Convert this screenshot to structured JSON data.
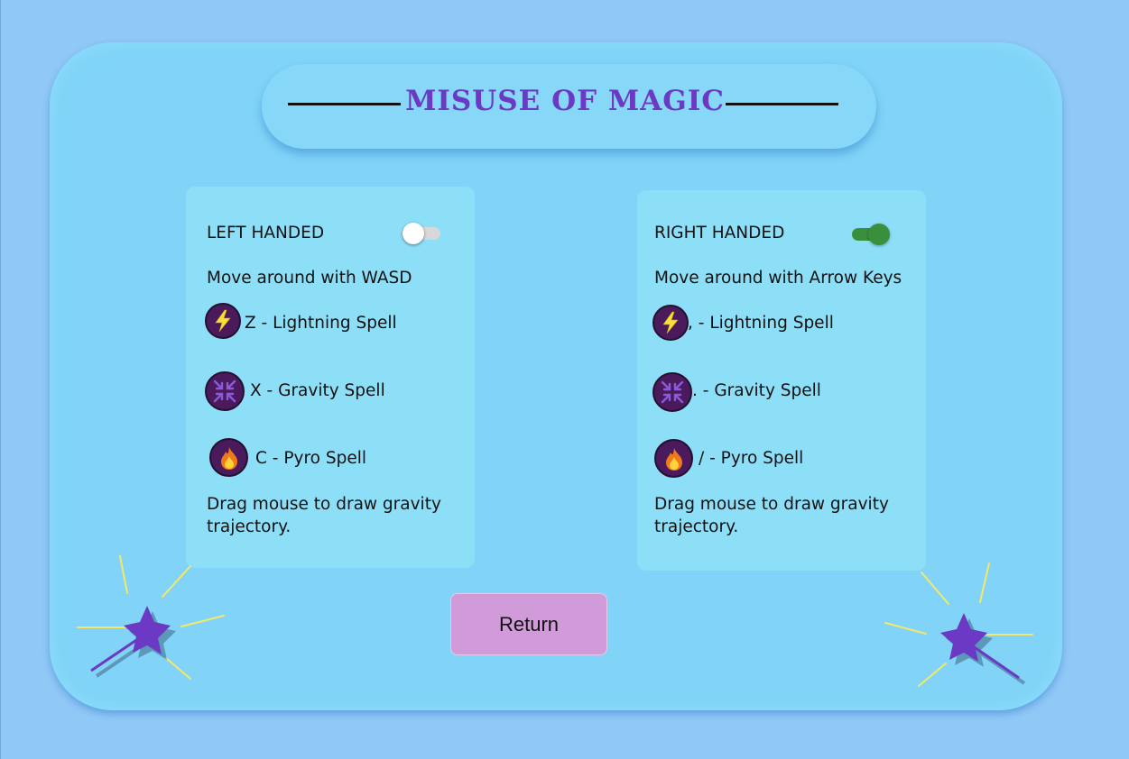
{
  "title": "MISUSE OF MAGIC",
  "left_card": {
    "heading": "LEFT HANDED",
    "toggle_on": false,
    "move": "Move around with WASD",
    "lightning": "Z - Lightning Spell",
    "gravity": "X - Gravity Spell",
    "pyro": "C - Pyro Spell",
    "drag": "Drag mouse to draw gravity trajectory."
  },
  "right_card": {
    "heading": "RIGHT HANDED",
    "toggle_on": true,
    "move": "Move around with Arrow Keys",
    "lightning": ", - Lightning Spell",
    "gravity": ". - Gravity Spell",
    "pyro": "/ - Pyro Spell",
    "drag": "Drag mouse to draw gravity trajectory."
  },
  "return_label": "Return",
  "icons": {
    "lightning": "lightning-icon",
    "gravity": "gravity-compress-icon",
    "pyro": "fire-icon",
    "wand": "magic-wand-icon"
  },
  "colors": {
    "background": "#90c8f6",
    "panel": "#81d4f7",
    "title": "#6b39c4",
    "toggle_on": "#3a8f3c",
    "return_button": "#d19ad8",
    "icon_bg": "#4a1a5c",
    "star": "#6b39c4"
  }
}
